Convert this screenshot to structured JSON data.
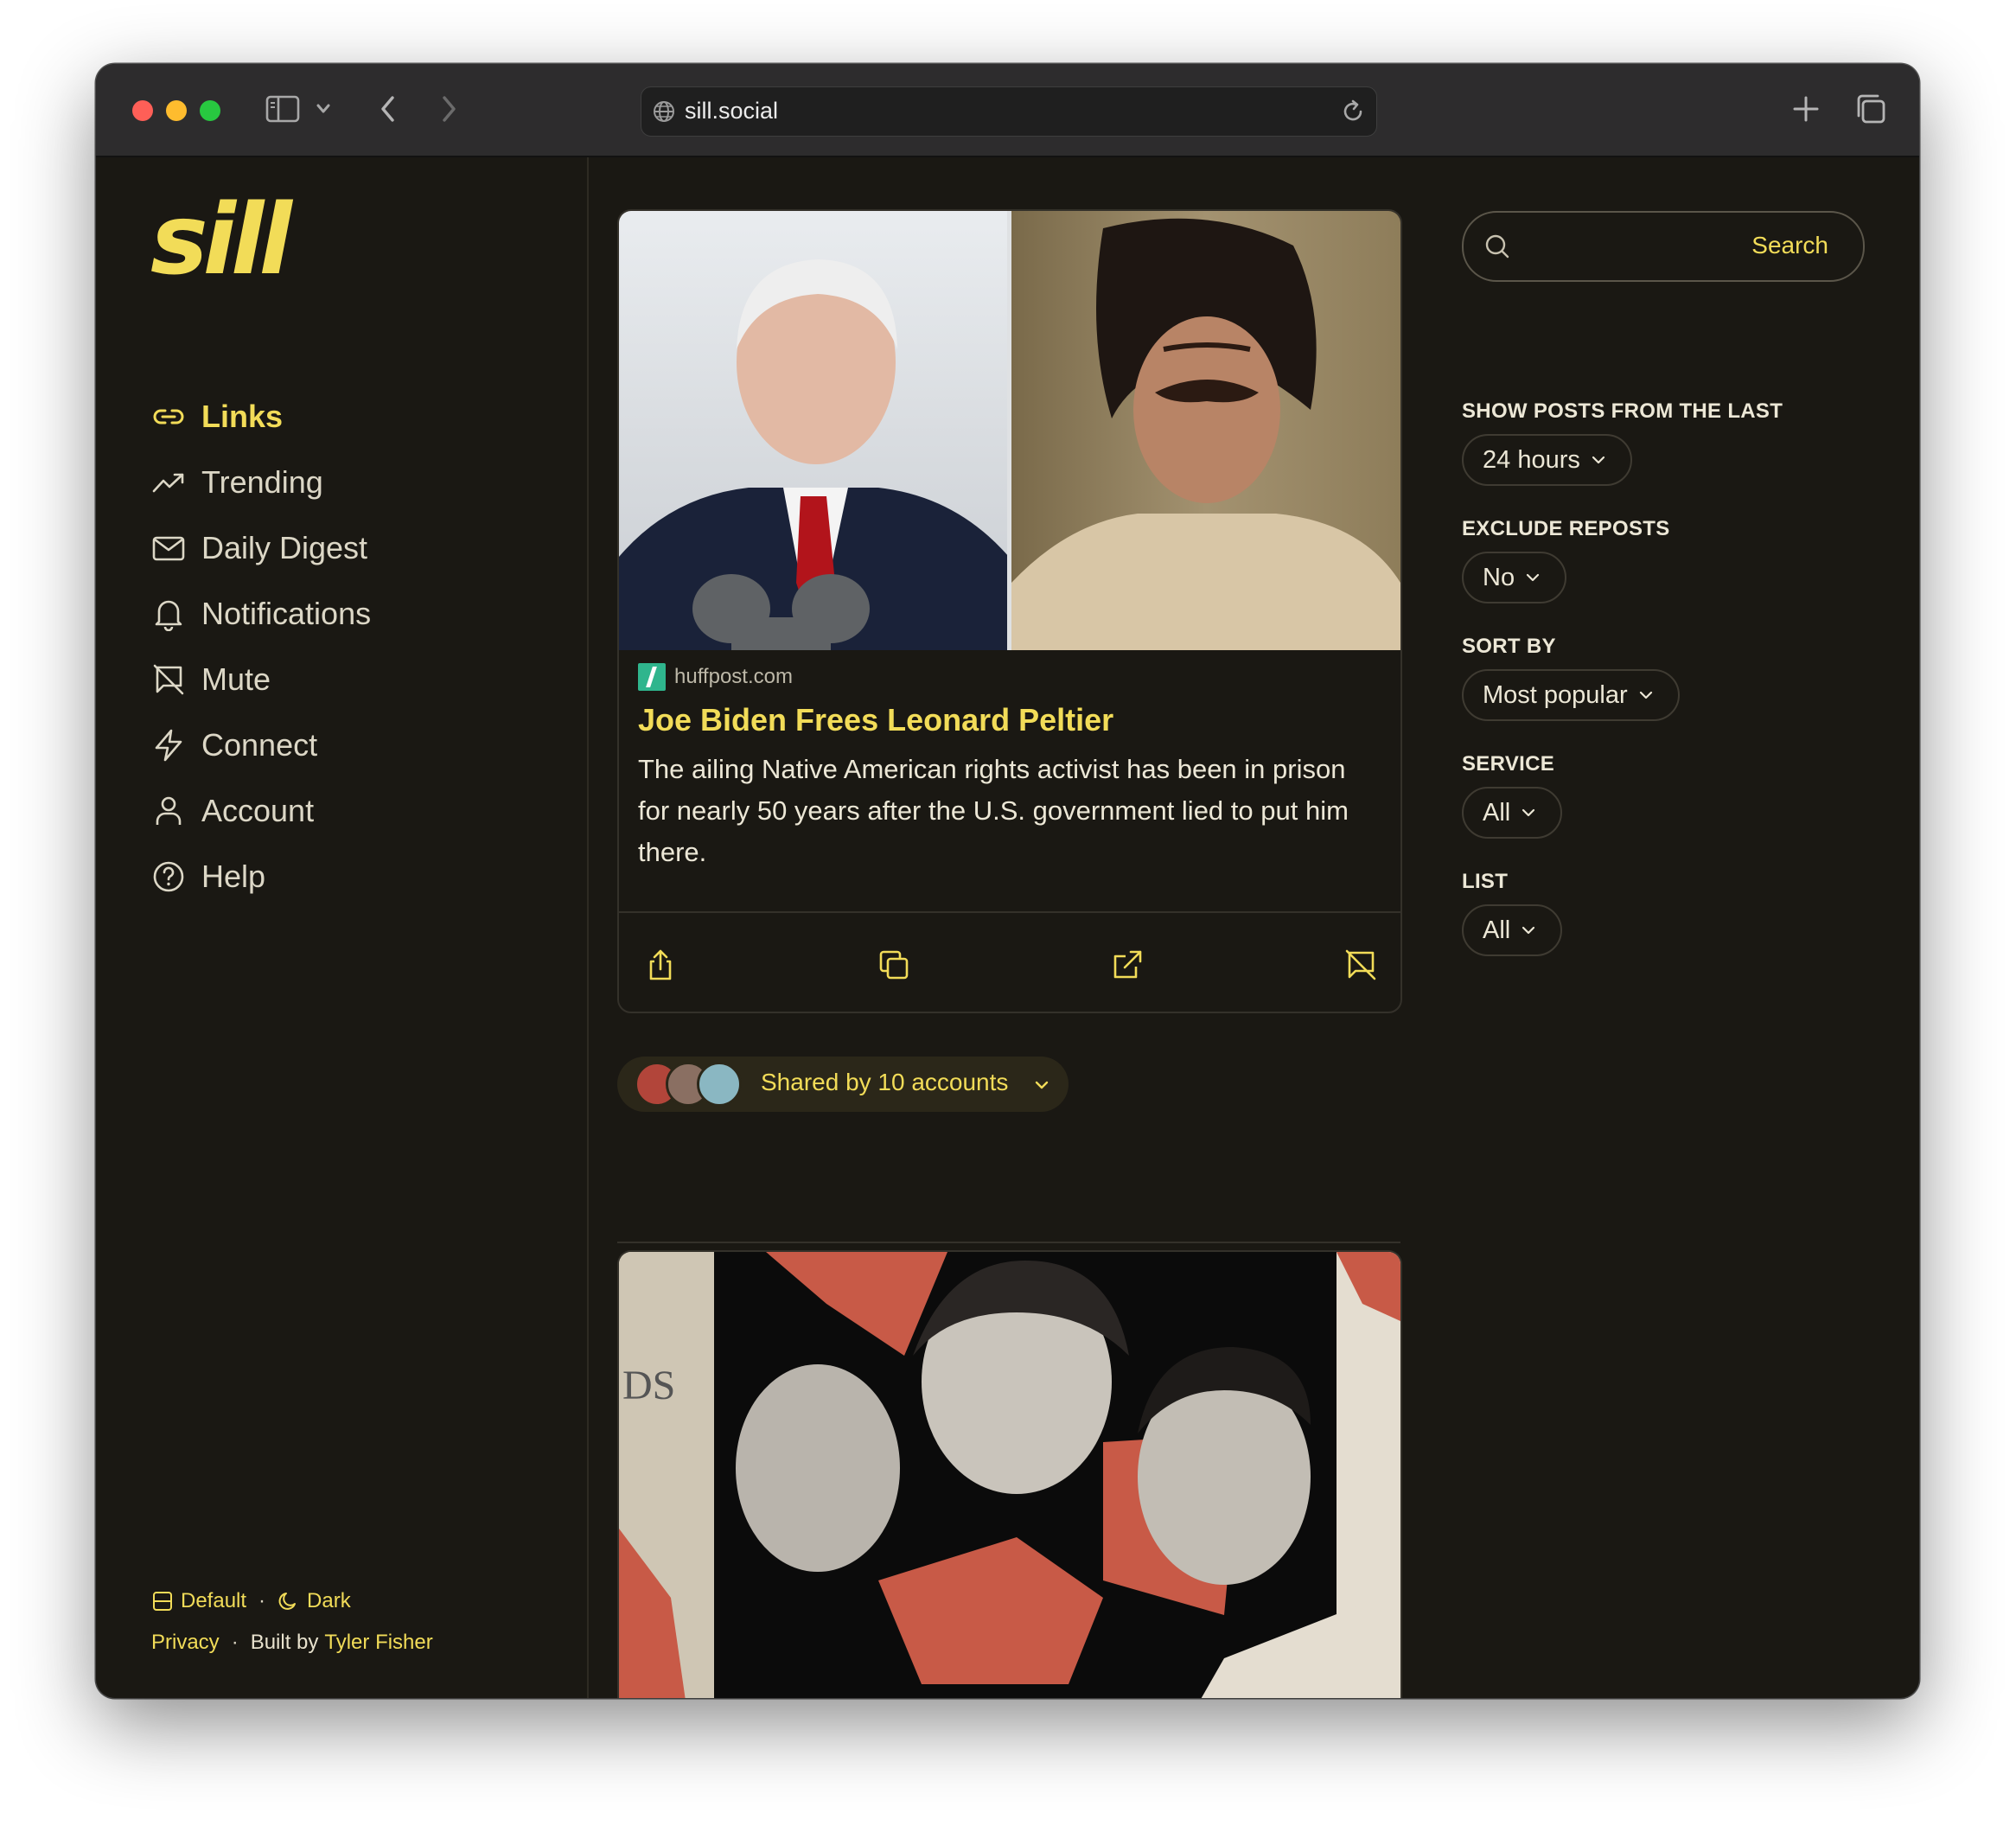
{
  "browser": {
    "url": "sill.social",
    "icons": [
      "sidebar-icon",
      "chevron-down-icon",
      "back-icon",
      "forward-icon",
      "globe-icon",
      "reload-icon",
      "new-tab-icon",
      "tabs-overview-icon"
    ]
  },
  "app": {
    "logo": "sill",
    "accent": "#f2dc58"
  },
  "nav": {
    "links": "Links",
    "trending": "Trending",
    "daily_digest": "Daily Digest",
    "notifications": "Notifications",
    "mute": "Mute",
    "connect": "Connect",
    "account": "Account",
    "help": "Help",
    "active": "Links"
  },
  "footer": {
    "theme_default": "Default",
    "theme_dark": "Dark",
    "privacy": "Privacy",
    "built_by": "Built by",
    "author": "Tyler Fisher"
  },
  "post": {
    "source": "huffpost.com",
    "title": "Joe Biden Frees Leonard Peltier",
    "description": "The ailing Native American rights activist has been in prison for nearly 50 years after the U.S. government lied to put him there.",
    "actions": [
      "share-icon",
      "copy-icon",
      "open-external-icon",
      "mute-icon"
    ],
    "shared_by": "Shared by 10 accounts"
  },
  "filters": {
    "search_button": "Search",
    "time_label": "SHOW POSTS FROM THE LAST",
    "time_value": "24 hours",
    "reposts_label": "EXCLUDE REPOSTS",
    "reposts_value": "No",
    "sort_label": "SORT BY",
    "sort_value": "Most popular",
    "service_label": "SERVICE",
    "service_value": "All",
    "list_label": "LIST",
    "list_value": "All"
  }
}
